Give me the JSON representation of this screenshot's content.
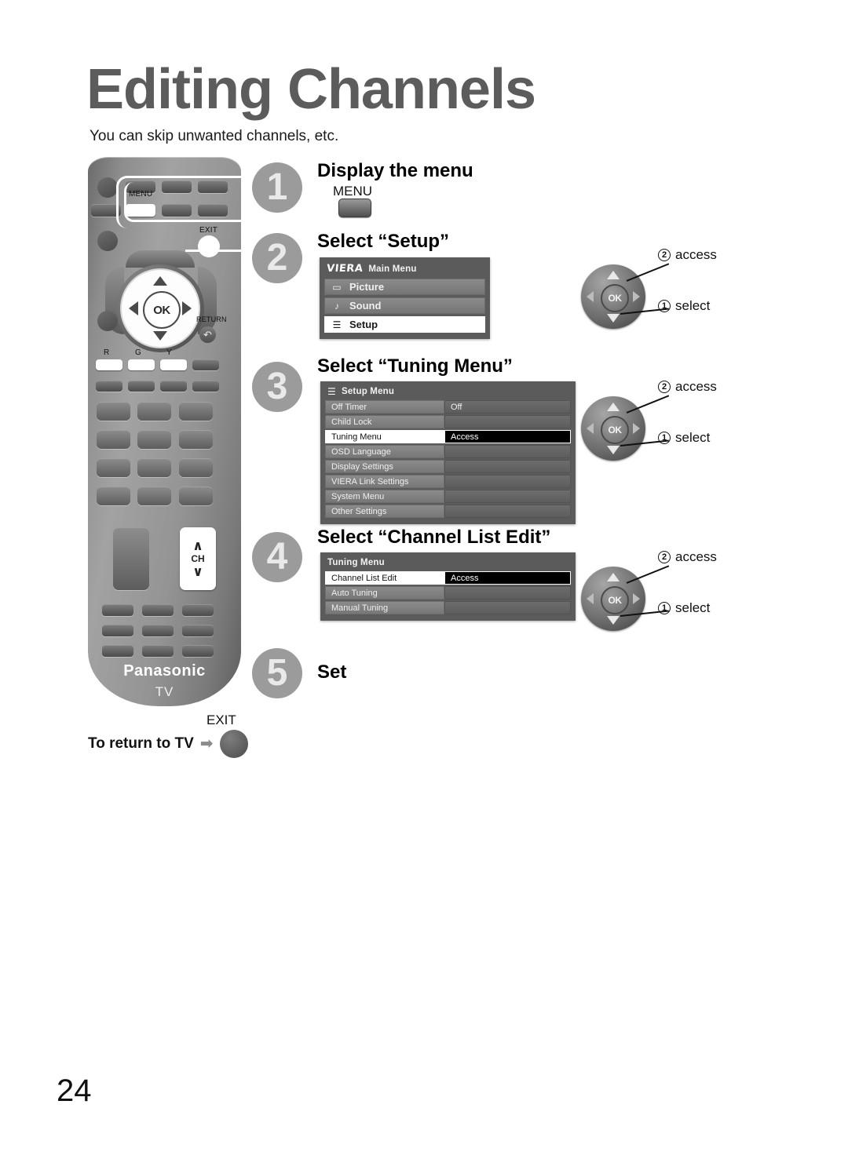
{
  "page": {
    "title": "Editing Channels",
    "subtitle": "You can skip unwanted channels, etc.",
    "number": "24"
  },
  "remote": {
    "menu_label": "MENU",
    "exit_label": "EXIT",
    "return_label": "RETURN",
    "ok_label": "OK",
    "ch_label": "CH",
    "ch_up": "∧",
    "ch_down": "∨",
    "color_buttons": [
      "R",
      "G",
      "Y"
    ],
    "brand": "Panasonic",
    "device": "TV"
  },
  "steps": [
    {
      "number": "1",
      "title": "Display the menu",
      "key_label": "MENU"
    },
    {
      "number": "2",
      "title": "Select “Setup”",
      "menu": {
        "brand": "VIERA",
        "header": "Main Menu",
        "items": [
          {
            "icon": "picture-icon",
            "glyph": "▭",
            "label": "Picture",
            "selected": false
          },
          {
            "icon": "sound-icon",
            "glyph": "♪",
            "label": "Sound",
            "selected": false
          },
          {
            "icon": "setup-icon",
            "glyph": "☰",
            "label": "Setup",
            "selected": true
          }
        ]
      },
      "annotations": [
        {
          "num": "2",
          "text": "access"
        },
        {
          "num": "1",
          "text": "select"
        }
      ]
    },
    {
      "number": "3",
      "title": "Select “Tuning Menu”",
      "menu": {
        "header": "Setup Menu",
        "header_icon": "list-icon",
        "rows": [
          {
            "label": "Off Timer",
            "value": "Off",
            "selected": false
          },
          {
            "label": "Child Lock",
            "value": "",
            "selected": false
          },
          {
            "label": "Tuning Menu",
            "value": "Access",
            "selected": true
          },
          {
            "label": "OSD Language",
            "value": "",
            "selected": false
          },
          {
            "label": "Display Settings",
            "value": "",
            "selected": false
          },
          {
            "label": "VIERA Link Settings",
            "value": "",
            "selected": false
          },
          {
            "label": "System Menu",
            "value": "",
            "selected": false
          },
          {
            "label": "Other Settings",
            "value": "",
            "selected": false
          }
        ]
      },
      "annotations": [
        {
          "num": "2",
          "text": "access"
        },
        {
          "num": "1",
          "text": "select"
        }
      ]
    },
    {
      "number": "4",
      "title": "Select “Channel List Edit”",
      "menu": {
        "header": "Tuning Menu",
        "rows": [
          {
            "label": "Channel List Edit",
            "value": "Access",
            "selected": true
          },
          {
            "label": "Auto Tuning",
            "value": "",
            "selected": false
          },
          {
            "label": "Manual Tuning",
            "value": "",
            "selected": false
          }
        ]
      },
      "annotations": [
        {
          "num": "2",
          "text": "access"
        },
        {
          "num": "1",
          "text": "select"
        }
      ]
    },
    {
      "number": "5",
      "title": "Set"
    }
  ],
  "footer": {
    "return_text": "To return to TV",
    "arrow": "➡",
    "exit_label": "EXIT"
  },
  "colors": {
    "heading": "#5c5c5c",
    "badge": "#9b9b9b",
    "osd_bg": "#5b5b5b",
    "selected_value_bg": "#000000"
  }
}
